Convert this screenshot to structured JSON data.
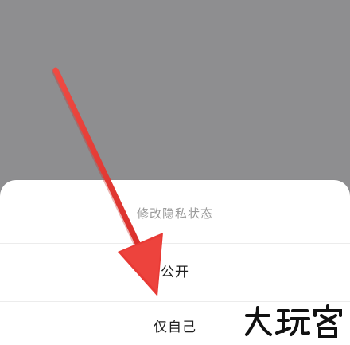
{
  "sheet": {
    "title": "修改隐私状态",
    "options": [
      {
        "label": "公开"
      },
      {
        "label": "仅自己"
      }
    ]
  },
  "annotation": {
    "arrow_color": "#e83a35"
  },
  "watermark": {
    "text": "大玩客"
  },
  "colors": {
    "backdrop": "#8e8e90",
    "sheet_bg": "#ffffff",
    "title_text": "#9a9a9a",
    "option_text": "#1f1f1f",
    "divider": "#ececec"
  }
}
